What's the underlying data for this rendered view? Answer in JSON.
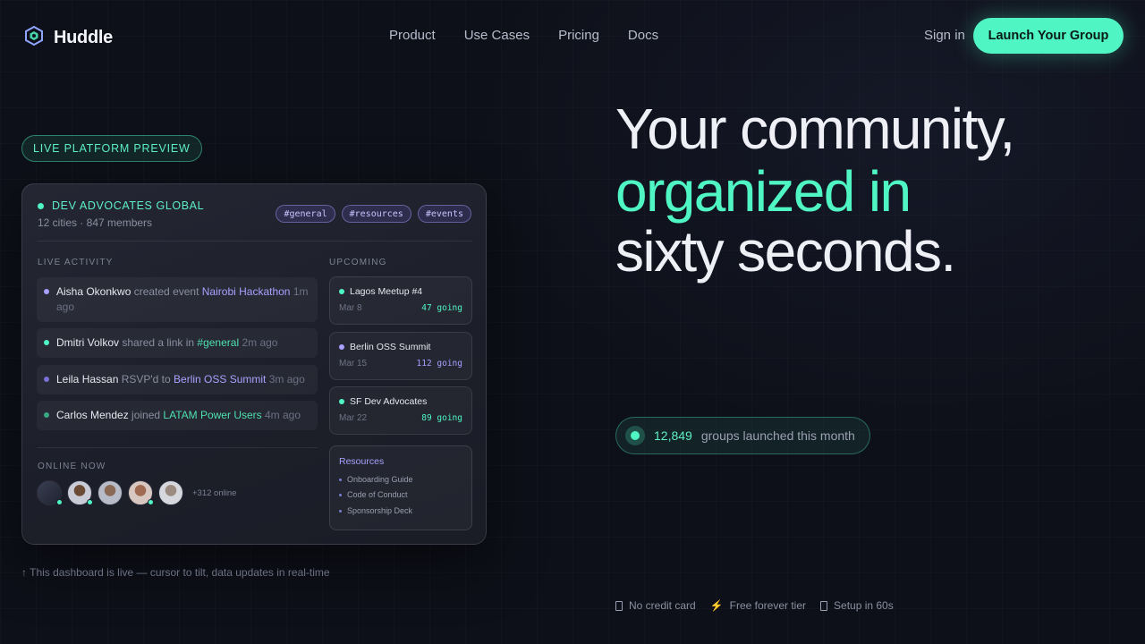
{
  "nav": {
    "brand": "Huddle",
    "links": [
      "Product",
      "Use Cases",
      "Pricing",
      "Docs"
    ],
    "signin": "Sign in",
    "cta": "Launch Your Group"
  },
  "preview": {
    "pill": "LIVE PLATFORM PREVIEW",
    "group_name": "DEV ADVOCATES GLOBAL",
    "group_meta": "12 cities · 847 members",
    "channels": [
      "#general",
      "#resources",
      "#events"
    ],
    "activity_label": "LIVE ACTIVITY",
    "activity": [
      {
        "who": "Aisha Okonkwo",
        "action": " created event ",
        "target": "Nairobi Hackathon",
        "ago": " 1m ago",
        "color": "#a9a1ff"
      },
      {
        "who": "Dmitri Volkov",
        "action": " shared a link in ",
        "target": "#general",
        "ago": " 2m ago",
        "color": "#4fe0b0"
      },
      {
        "who": "Leila Hassan",
        "action": " RSVP'd to ",
        "target": "Berlin OSS Summit",
        "ago": " 3m ago",
        "color": "#a9a1ff"
      },
      {
        "who": "Carlos Mendez",
        "action": " joined ",
        "target": "LATAM Power Users",
        "ago": " 4m ago",
        "color": "#4fe0b0"
      }
    ],
    "upcoming_label": "UPCOMING",
    "events": [
      {
        "title": "Lagos Meetup #4",
        "date": "Mar 8",
        "going": "47 going",
        "color": "#4ff5c3"
      },
      {
        "title": "Berlin OSS Summit",
        "date": "Mar 15",
        "going": "112 going",
        "color": "#a9a1ff"
      },
      {
        "title": "SF Dev Advocates",
        "date": "Mar 22",
        "going": "89 going",
        "color": "#4ff5c3"
      }
    ],
    "resources_title": "Resources",
    "resources": [
      "Onboarding Guide",
      "Code of Conduct",
      "Sponsorship Deck"
    ],
    "online_label": "ONLINE NOW",
    "online_more": "+312 online",
    "hint": "↑ This dashboard is live — cursor to tilt, data updates in real-time"
  },
  "hero": {
    "line1": "Your community,",
    "line2": "organized in",
    "line3": "sixty seconds.",
    "counter_value": "12,849",
    "counter_label": "groups launched this month",
    "features": [
      "No credit card",
      "Free forever tier",
      "Setup in 60s"
    ]
  },
  "colors": {
    "accent": "#4ff5c3",
    "purple": "#a9a1ff",
    "bg": "#0e1019"
  }
}
